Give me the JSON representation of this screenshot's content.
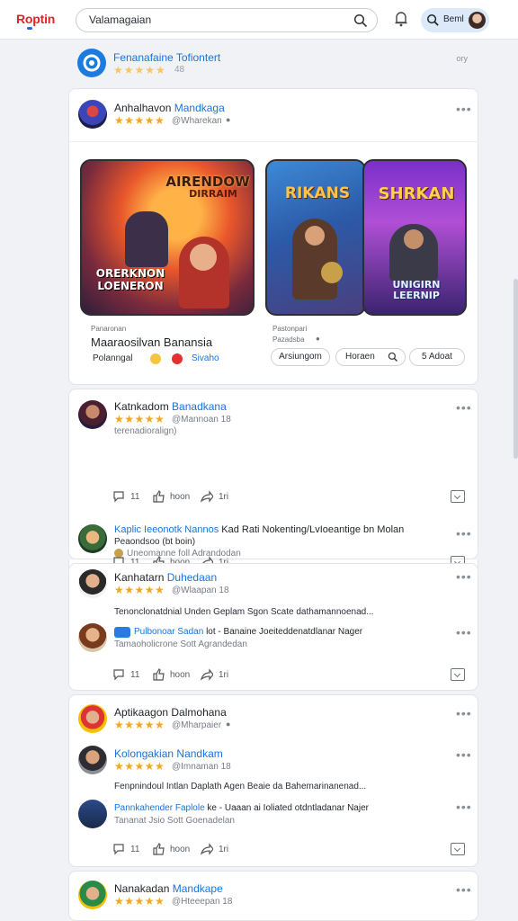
{
  "header": {
    "logo": "Roptin",
    "search_value": "Valamagaian",
    "profile_name": "Beml"
  },
  "suggestion": {
    "title": "Fenanafaine Tofiontert",
    "stars": "★★★★★",
    "count": "48",
    "meta": "ory"
  },
  "featured": {
    "user": {
      "name_a": "Anhalhavon",
      "name_b": "Mandkaga",
      "stars": "★★★★★",
      "handle": "@Wharekan"
    },
    "games": [
      {
        "label_top": "AIRENDOW",
        "label_sub": "DIRRAIM",
        "label_bottom": "ORERKNON\nLOENERON"
      },
      {
        "label_top": "RIKANS",
        "label_bottom": ""
      },
      {
        "label_top": "SHRKAN",
        "label_bottom": "UNIGIRN\nLEERNIP"
      }
    ],
    "left_meta": "Panaronan",
    "left_title": "Maaraosilvan Banansia",
    "left_tag": "Polanngal",
    "left_link": "Sivaho",
    "right_meta": "Pastonpari",
    "right_sub": "Pazadsba",
    "pills": [
      "Arsiungom",
      "Horaen",
      "5 Adoat"
    ]
  },
  "posts": [
    {
      "name_a": "Katnkadom",
      "name_b": "Banadkana",
      "stars": "★★★★★",
      "handle": "@Mannoan 18",
      "sub": "terenadioralign)",
      "comments": "11",
      "likes": "hoon",
      "shares": "1ri"
    },
    {
      "name_a": "Kaplic Ieeonotk Nannos",
      "name_b": "Kad Rati Nokenting/LvIoeantige bn Molan",
      "line2": "Peaondsoo (bt boin)",
      "handle": "Uneomanne foll Adrandodan",
      "comments": "11",
      "likes": "hoon",
      "shares": "1ri"
    },
    {
      "name_a": "Kanhatarn",
      "name_b": "Duhedaan",
      "stars": "★★★★★",
      "handle": "@Wlaapan 18",
      "body": "Tenonclonatdnial Unden Geplam Sgon Scate dathamannoenad...",
      "reply_name": "Pulbonoar Sadan",
      "reply_rest": "lot - Banaine Joeiteddenatdlanar Nager",
      "reply_handle": "Tamaoholicrone Sott Agrandedan",
      "comments": "11",
      "likes": "hoon",
      "shares": "1ri"
    },
    {
      "name_a": "Aptikaagon",
      "name_b": "Dalmohana",
      "stars": "★★★★★",
      "handle": "@Mharpaier",
      "reply1_name": "Kolongakian",
      "reply1_b": "Nandkam",
      "reply1_stars": "★★★★★",
      "reply1_handle": "@Imnaman 18",
      "body": "Fenpnindoul Intlan Daplath Agen Beaie da Bahemarinanenad...",
      "reply2_name": "Pannkahender Faplole",
      "reply2_rest": "ke - Uaaan ai Ioliated otdntladanar Najer",
      "reply2_handle": "Tananat Jsio Sott Goenadelan",
      "comments": "11",
      "likes": "hoon",
      "shares": "1ri"
    },
    {
      "name_a": "Nanakadan",
      "name_b": "Mandkape",
      "stars": "★★★★★",
      "handle": "@Hteeepan 18"
    }
  ]
}
